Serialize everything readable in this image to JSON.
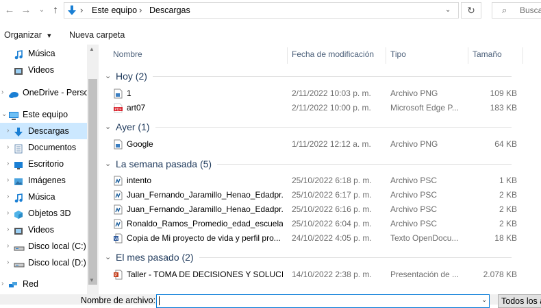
{
  "address": {
    "crumbs": [
      "Este equipo",
      "Descargas"
    ],
    "search_placeholder": "Busca"
  },
  "toolbar": {
    "organize_label": "Organizar",
    "new_folder_label": "Nueva carpeta"
  },
  "nav": {
    "items": [
      {
        "label": "Música",
        "icon": "music-icon",
        "color": "#1a7fd4"
      },
      {
        "label": "Videos",
        "icon": "video-icon",
        "color": "#555555"
      },
      {
        "label": "OneDrive - Persor",
        "icon": "cloud-icon",
        "color": "#1a7fd4"
      },
      {
        "label": "Este equipo",
        "icon": "computer-icon",
        "color": "#1a7fd4"
      },
      {
        "label": "Descargas",
        "icon": "download-icon",
        "color": "#1a7fd4"
      },
      {
        "label": "Documentos",
        "icon": "documents-icon",
        "color": "#6b8fb5"
      },
      {
        "label": "Escritorio",
        "icon": "desktop-icon",
        "color": "#1a7fd4"
      },
      {
        "label": "Imágenes",
        "icon": "images-icon",
        "color": "#4aa3df"
      },
      {
        "label": "Música",
        "icon": "music-icon",
        "color": "#1a7fd4"
      },
      {
        "label": "Objetos 3D",
        "icon": "cube-icon",
        "color": "#4fb3e8"
      },
      {
        "label": "Videos",
        "icon": "video-icon",
        "color": "#555555"
      },
      {
        "label": "Disco local (C:)",
        "icon": "drive-icon",
        "color": "#555555"
      },
      {
        "label": "Disco local (D:)",
        "icon": "drive-icon",
        "color": "#555555"
      },
      {
        "label": "Red",
        "icon": "network-icon",
        "color": "#1a7fd4"
      }
    ]
  },
  "columns": {
    "name": "Nombre",
    "date": "Fecha de modificación",
    "type": "Tipo",
    "size": "Tamaño"
  },
  "groups": [
    {
      "label": "Hoy (2)",
      "files": [
        {
          "name": "1",
          "date": "2/11/2022 10:03 p. m.",
          "type": "Archivo PNG",
          "size": "109 KB",
          "icon": "image-file-icon"
        },
        {
          "name": "art07",
          "date": "2/11/2022 10:00 p. m.",
          "type": "Microsoft Edge P...",
          "size": "183 KB",
          "icon": "pdf-file-icon"
        }
      ]
    },
    {
      "label": "Ayer (1)",
      "files": [
        {
          "name": "Google",
          "date": "1/11/2022 12:12 a. m.",
          "type": "Archivo PNG",
          "size": "64 KB",
          "icon": "image-file-icon"
        }
      ]
    },
    {
      "label": "La semana pasada (5)",
      "files": [
        {
          "name": "intento",
          "date": "25/10/2022 6:18 p. m.",
          "type": "Archivo PSC",
          "size": "1 KB",
          "icon": "psc-file-icon"
        },
        {
          "name": "Juan_Fernando_Jaramillo_Henao_Edadpr...",
          "date": "25/10/2022 6:17 p. m.",
          "type": "Archivo PSC",
          "size": "2 KB",
          "icon": "psc-file-icon"
        },
        {
          "name": "Juan_Fernando_Jaramillo_Henao_Edadpr...",
          "date": "25/10/2022 6:16 p. m.",
          "type": "Archivo PSC",
          "size": "2 KB",
          "icon": "psc-file-icon"
        },
        {
          "name": "Ronaldo_Ramos_Promedio_edad_escuela",
          "date": "25/10/2022 6:04 p. m.",
          "type": "Archivo PSC",
          "size": "2 KB",
          "icon": "psc-file-icon"
        },
        {
          "name": "Copia de Mi proyecto de vida y perfil pro...",
          "date": "24/10/2022 4:05 p. m.",
          "type": "Texto OpenDocu...",
          "size": "18 KB",
          "icon": "word-file-icon"
        }
      ]
    },
    {
      "label": "El mes pasado (2)",
      "files": [
        {
          "name": "Taller - TOMA DE DECISIONES Y SOLUCIÓ...",
          "date": "14/10/2022 2:38 p. m.",
          "type": "Presentación de ...",
          "size": "2.078 KB",
          "icon": "ppt-file-icon"
        }
      ]
    }
  ],
  "bottom": {
    "filename_label": "Nombre de archivo:",
    "filename_value": "",
    "filetype_label": "Todos los a"
  }
}
